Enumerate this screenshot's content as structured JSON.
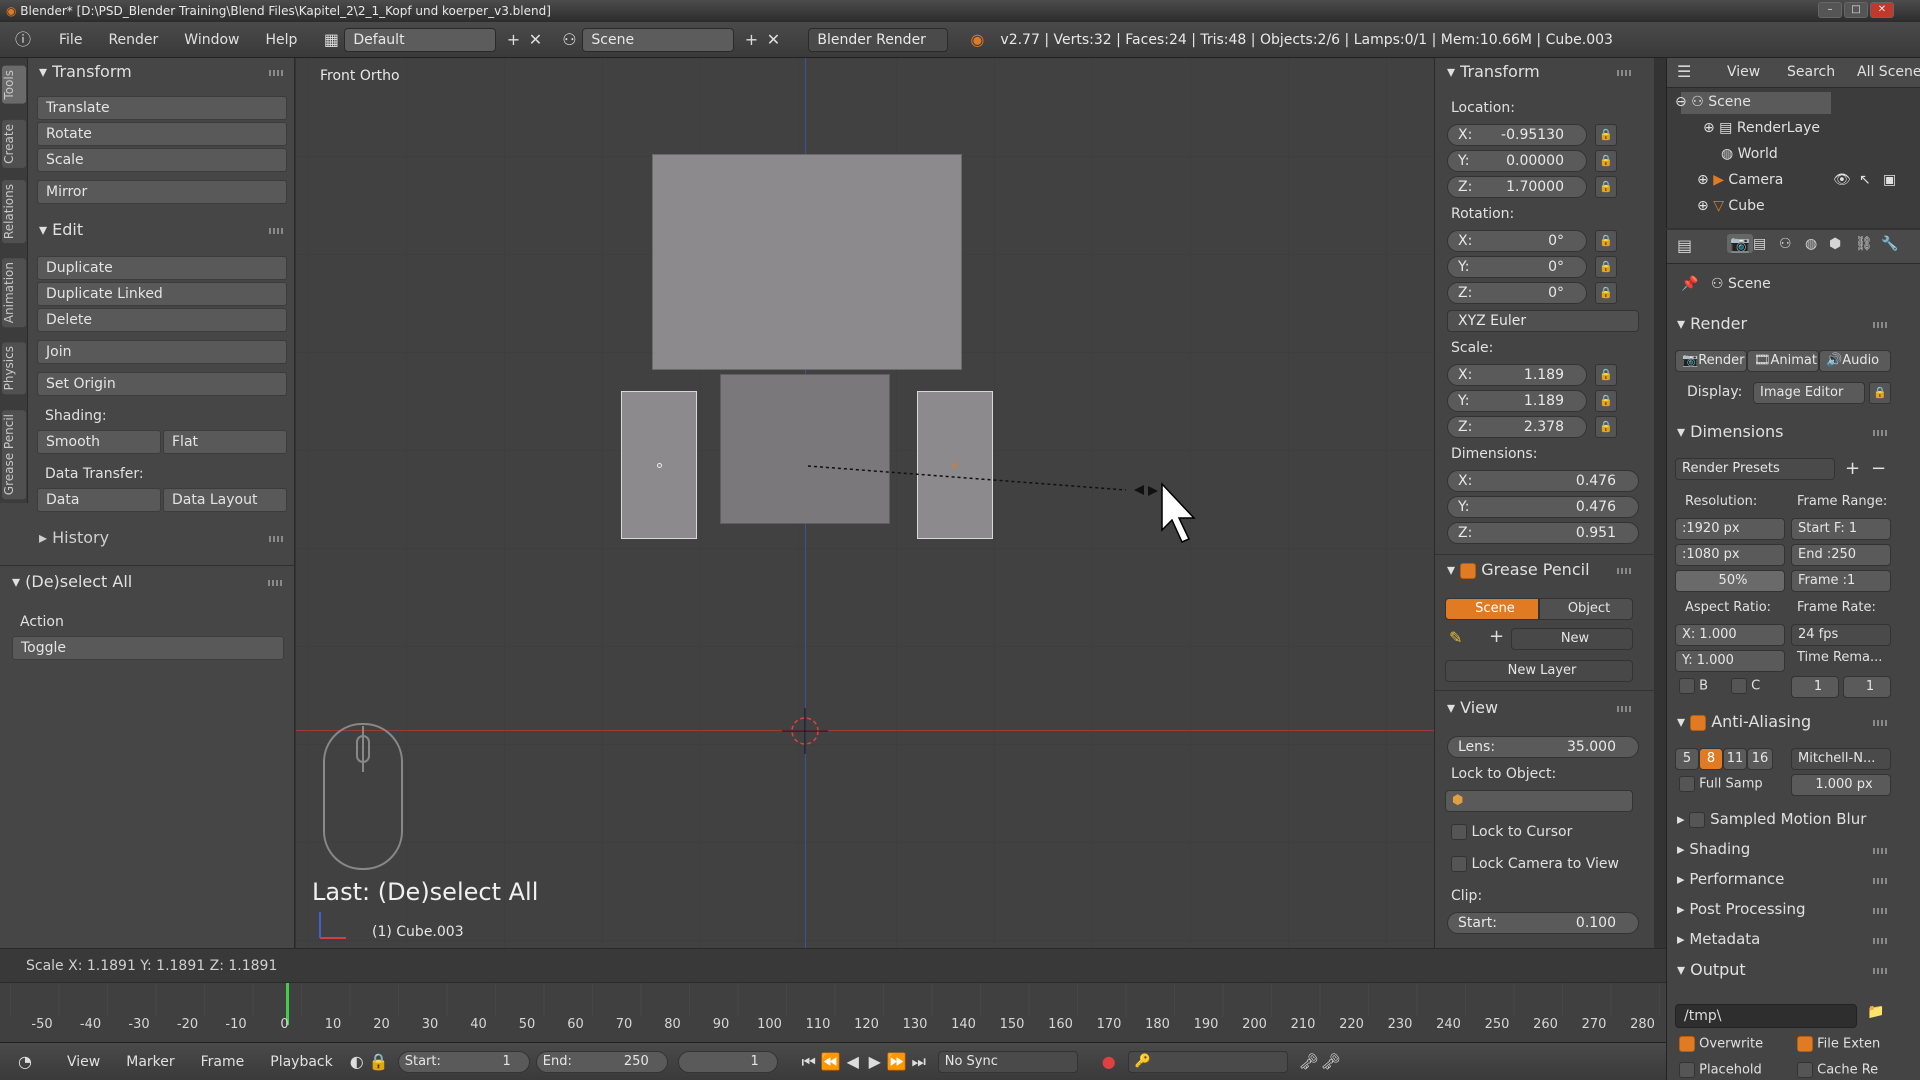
{
  "window": {
    "title": "Blender* [D:\\PSD_Blender Training\\Blend Files\\Kapitel_2\\2_1_Kopf und koerper_v3.blend]"
  },
  "menu": {
    "items": [
      "File",
      "Render",
      "Window",
      "Help"
    ]
  },
  "header": {
    "layout": "Default",
    "scene": "Scene",
    "engine": "Blender Render",
    "stats": "v2.77 | Verts:32 | Faces:24 | Tris:48 | Objects:2/6 | Lamps:0/1 | Mem:10.66M | Cube.003"
  },
  "tool_tabs": [
    "Tools",
    "Create",
    "Relations",
    "Animation",
    "Physics",
    "Grease Pencil"
  ],
  "toolshelf": {
    "transform": {
      "title": "Transform",
      "buttons": [
        "Translate",
        "Rotate",
        "Scale",
        "Mirror"
      ]
    },
    "edit": {
      "title": "Edit",
      "buttons": [
        "Duplicate",
        "Duplicate Linked",
        "Delete",
        "Join",
        "Set Origin"
      ],
      "shading_label": "Shading:",
      "shading": [
        "Smooth",
        "Flat"
      ],
      "data_transfer_label": "Data Transfer:",
      "data_transfer": [
        "Data",
        "Data Layout"
      ]
    },
    "history": "History",
    "operator": {
      "title": "(De)select All",
      "action_label": "Action",
      "action_value": "Toggle"
    }
  },
  "viewport": {
    "view_name": "Front Ortho",
    "last_op": "Last: (De)select All",
    "object_info": "(1) Cube.003"
  },
  "status": {
    "scale_readout": "Scale X: 1.1891   Y: 1.1891   Z: 1.1891"
  },
  "npanel": {
    "transform": "Transform",
    "location_label": "Location:",
    "location": [
      {
        "k": "X:",
        "v": "-0.95130"
      },
      {
        "k": "Y:",
        "v": "0.00000"
      },
      {
        "k": "Z:",
        "v": "1.70000"
      }
    ],
    "rotation_label": "Rotation:",
    "rotation": [
      {
        "k": "X:",
        "v": "0°"
      },
      {
        "k": "Y:",
        "v": "0°"
      },
      {
        "k": "Z:",
        "v": "0°"
      }
    ],
    "rotation_mode": "XYZ Euler",
    "scale_label": "Scale:",
    "scale": [
      {
        "k": "X:",
        "v": "1.189"
      },
      {
        "k": "Y:",
        "v": "1.189"
      },
      {
        "k": "Z:",
        "v": "2.378"
      }
    ],
    "dimensions_label": "Dimensions:",
    "dimensions": [
      {
        "k": "X:",
        "v": "0.476"
      },
      {
        "k": "Y:",
        "v": "0.476"
      },
      {
        "k": "Z:",
        "v": "0.951"
      }
    ],
    "grease_pencil": "Grease Pencil",
    "gp_tabs": [
      "Scene",
      "Object"
    ],
    "gp_new": "New",
    "gp_new_layer": "New Layer",
    "view": "View",
    "lens_label": "Lens:",
    "lens_value": "35.000",
    "lock_to_object": "Lock to Object:",
    "lock_to_cursor": "Lock to Cursor",
    "lock_camera": "Lock Camera to View",
    "clip_label": "Clip:",
    "clip_start_label": "Start:",
    "clip_start": "0.100"
  },
  "outliner": {
    "menu": [
      "View",
      "Search",
      "All Scenes"
    ],
    "items": [
      "Scene",
      "RenderLaye",
      "World",
      "Camera",
      "Cube"
    ]
  },
  "properties": {
    "scene": "Scene",
    "render": {
      "title": "Render",
      "buttons": [
        "Render",
        "Animat",
        "Audio"
      ],
      "display_label": "Display:",
      "display_value": "Image Editor"
    },
    "dimensions": {
      "title": "Dimensions",
      "presets": "Render Presets",
      "resolution_label": "Resolution:",
      "res_x": ":1920 px",
      "res_y": ":1080 px",
      "res_pct": "50%",
      "frame_range_label": "Frame Range:",
      "start": "Start F: 1",
      "end": "End :250",
      "frame": "Frame :1",
      "aspect_label": "Aspect Ratio:",
      "aspect_x": "X:  1.000",
      "aspect_y": "Y:  1.000",
      "frame_rate_label": "Frame Rate:",
      "fps": "24 fps",
      "time_remap": "Time Rema...",
      "b": "B",
      "c": "C",
      "remap_old": "1",
      "remap_new": "1"
    },
    "aa": {
      "title": "Anti-Aliasing",
      "samples": [
        "5",
        "8",
        "11",
        "16"
      ],
      "filter": "Mitchell-N...",
      "full_sample": "Full Samp",
      "size": "1.000 px"
    },
    "collapsed": [
      "Sampled Motion Blur",
      "Shading",
      "Performance",
      "Post Processing",
      "Metadata"
    ],
    "output": {
      "title": "Output",
      "path": "/tmp\\",
      "overwrite": "Overwrite",
      "file_ext": "File Exten",
      "placeholders": "Placehold",
      "cache": "Cache Re"
    }
  },
  "timeline": {
    "ticks": [
      "-50",
      "-40",
      "-30",
      "-20",
      "-10",
      "0",
      "10",
      "20",
      "30",
      "40",
      "50",
      "60",
      "70",
      "80",
      "90",
      "100",
      "110",
      "120",
      "130",
      "140",
      "150",
      "160",
      "170",
      "180",
      "190",
      "200",
      "210",
      "220",
      "230",
      "240",
      "250",
      "260",
      "270",
      "280"
    ]
  },
  "timebar": {
    "menu": [
      "View",
      "Marker",
      "Frame",
      "Playback"
    ],
    "start_label": "Start:",
    "start": "1",
    "end_label": "End:",
    "end": "250",
    "current": "1",
    "sync": "No Sync"
  },
  "colors": {
    "accent": "#e07b24",
    "x_axis": "#9b3a3a",
    "z_axis": "#3f4fa0",
    "object": "#8c8a8c"
  }
}
